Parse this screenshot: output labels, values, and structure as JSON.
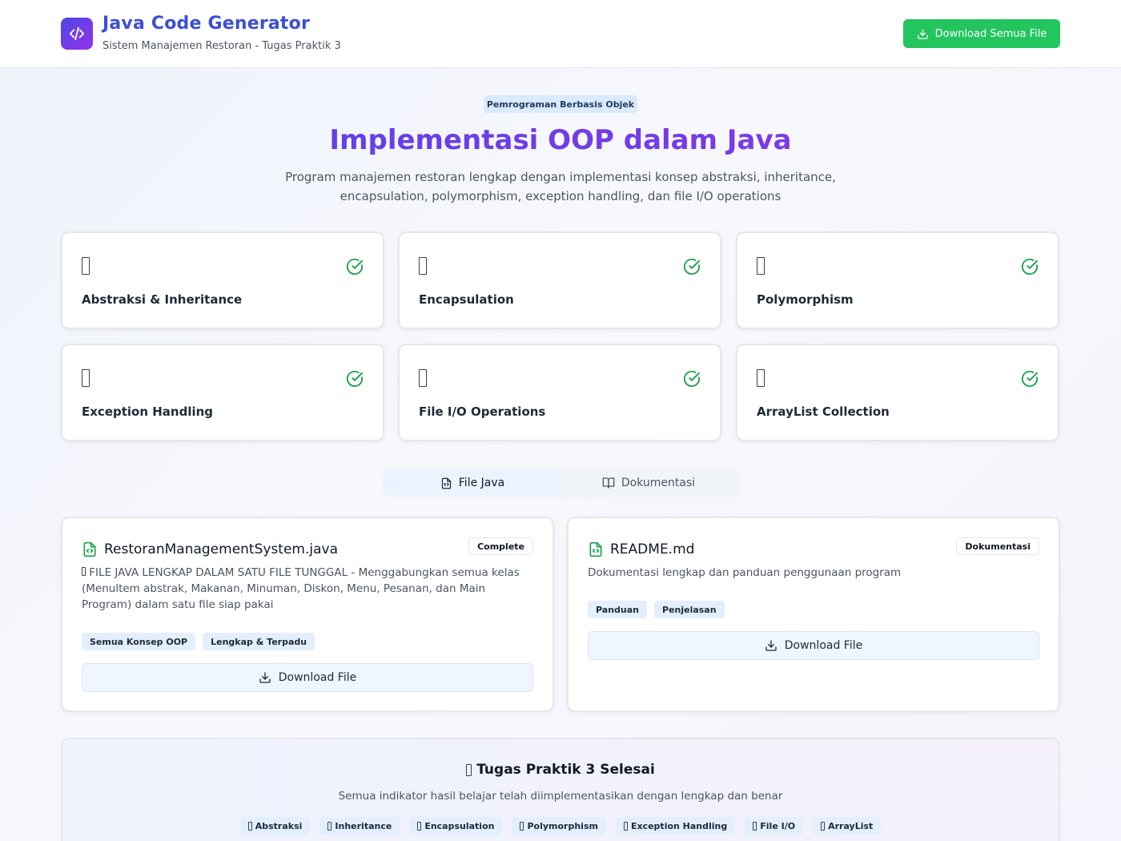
{
  "header": {
    "title": "Java Code Generator",
    "subtitle": "Sistem Manajemen Restoran - Tugas Praktik 3",
    "download_all_label": "Download Semua File"
  },
  "hero": {
    "badge": "Pemrograman Berbasis Objek",
    "title": "Implementasi OOP dalam Java",
    "description": "Program manajemen restoran lengkap dengan implementasi konsep abstraksi, inheritance, encapsulation, polymorphism, exception handling, dan file I/O operations"
  },
  "concepts": [
    {
      "label": "Abstraksi & Inheritance",
      "icon": "emoji-placeholder-icon",
      "status": "check-circle-icon"
    },
    {
      "label": "Encapsulation",
      "icon": "emoji-placeholder-icon",
      "status": "check-circle-icon"
    },
    {
      "label": "Polymorphism",
      "icon": "emoji-placeholder-icon",
      "status": "check-circle-icon"
    },
    {
      "label": "Exception Handling",
      "icon": "emoji-placeholder-icon",
      "status": "check-circle-icon"
    },
    {
      "label": "File I/O Operations",
      "icon": "emoji-placeholder-icon",
      "status": "check-circle-icon"
    },
    {
      "label": "ArrayList Collection",
      "icon": "emoji-placeholder-icon",
      "status": "check-circle-icon"
    }
  ],
  "tabs": [
    {
      "label": "File Java",
      "active": true
    },
    {
      "label": "Dokumentasi",
      "active": false
    }
  ],
  "files": [
    {
      "name": "RestoranManagementSystem.java",
      "badge": "Complete",
      "description": "FILE JAVA LENGKAP DALAM SATU FILE TUNGGAL - Menggabungkan semua kelas (Menultem abstrak, Makanan, Minuman, Diskon, Menu, Pesanan, dan Main Program) dalam satu file siap pakai",
      "tags": [
        "Semua Konsep OOP",
        "Lengkap & Terpadu"
      ],
      "download_label": "Download File"
    },
    {
      "name": "README.md",
      "badge": "Dokumentasi",
      "description": "Dokumentasi lengkap dan panduan penggunaan program",
      "tags": [
        "Panduan",
        "Penjelasan"
      ],
      "download_label": "Download File"
    }
  ],
  "summary": {
    "title": "Tugas Praktik 3 Selesai",
    "description": "Semua indikator hasil belajar telah diimplementasikan dengan lengkap dan benar",
    "tags": [
      "Abstraksi",
      "Inheritance",
      "Encapsulation",
      "Polymorphism",
      "Exception Handling",
      "File I/O",
      "ArrayList"
    ]
  },
  "colors": {
    "accent": "#4f46e5",
    "accent_purple": "#9333ea",
    "success": "#22c55e"
  }
}
